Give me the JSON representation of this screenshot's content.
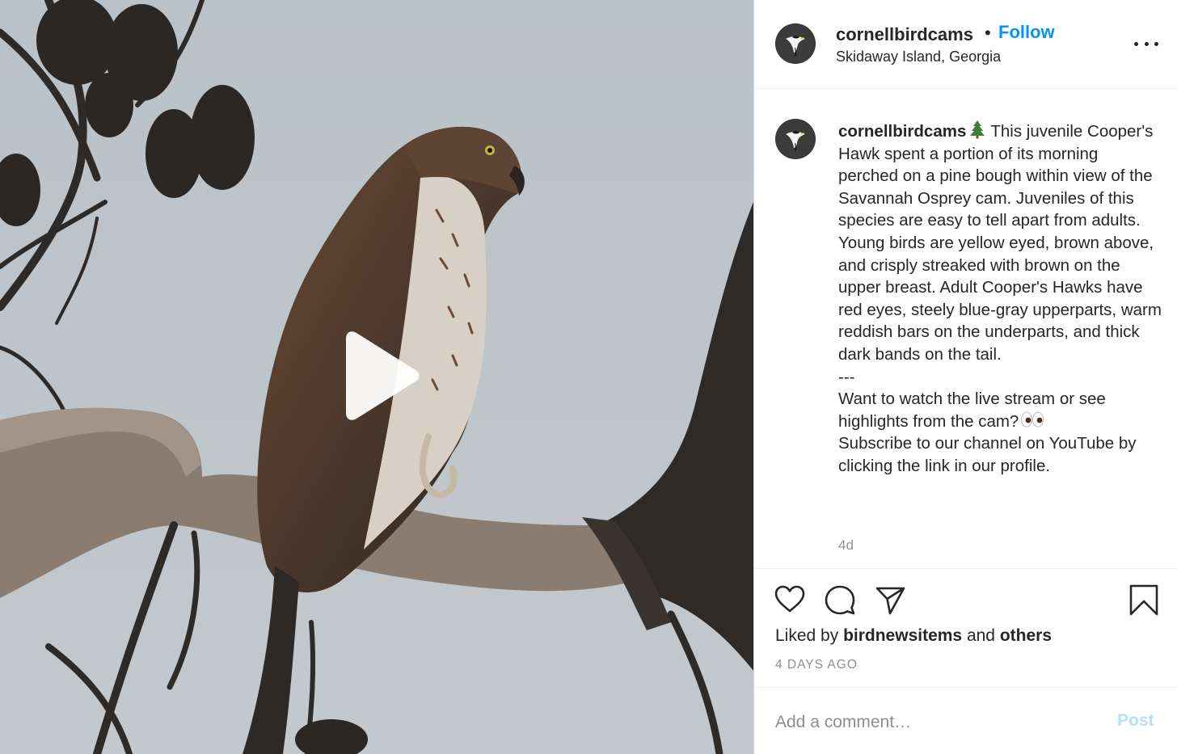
{
  "post": {
    "username": "cornellbirdcams",
    "follow_separator": "•",
    "follow_label": "Follow",
    "location": "Skidaway Island, Georgia",
    "more_icon": "more-horizontal-icon"
  },
  "media": {
    "kind": "video",
    "play_icon": "play-icon"
  },
  "caption": {
    "username": "cornellbirdcams",
    "lines": [
      "This juvenile Cooper's Hawk spent a portion of its morning perched on a pine bough within view of the Savannah Osprey cam. Juveniles of this species are easy to tell apart from adults. Young birds are yellow eyed, brown above, and crisply streaked with brown on the upper breast. Adult Cooper's Hawks have red eyes, steely blue-gray upperparts, warm reddish bars on the underparts, and thick dark bands on the tail.",
      "---",
      "Want to watch the live stream or see highlights from the cam?",
      "Subscribe to our channel on YouTube by clicking the link in our profile."
    ],
    "time_ago": "4d"
  },
  "actions": {
    "liked_prefix": "Liked by",
    "liked_user": "birdnewsitems",
    "liked_and": "and",
    "liked_others": "others",
    "date": "4 DAYS AGO"
  },
  "comment": {
    "placeholder": "Add a comment…",
    "post_label": "Post"
  },
  "colors": {
    "link_blue": "#0095f6",
    "post_disabled": "#b2dffc",
    "muted": "#8e8e8e",
    "text": "#262626"
  }
}
